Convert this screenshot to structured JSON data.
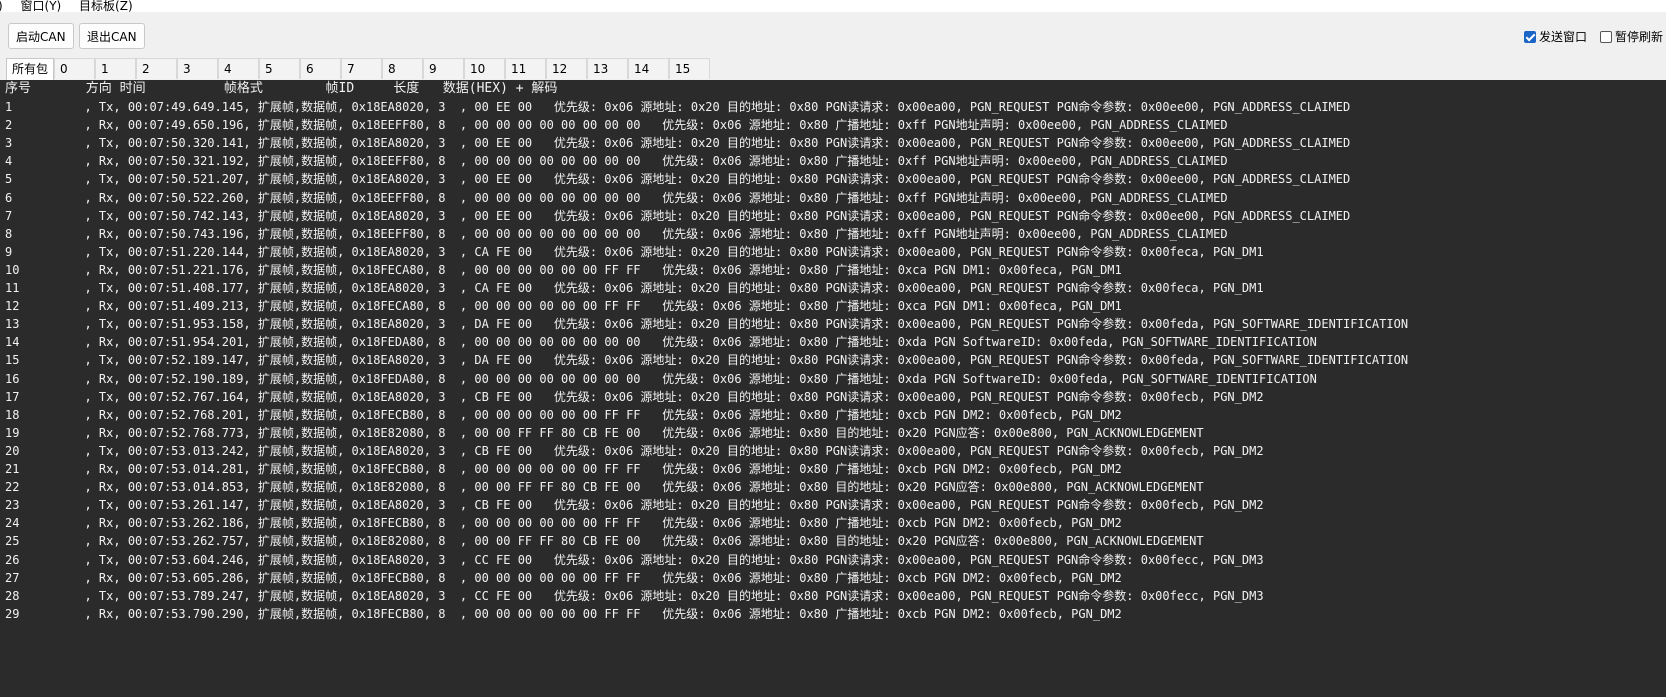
{
  "menu": {
    "lead": ")",
    "items": [
      "窗口(Y)",
      "目标板(Z)"
    ]
  },
  "toolbar": {
    "start_can": "启动CAN",
    "exit_can": "退出CAN",
    "send_window_label": "发送窗口",
    "send_window_checked": true,
    "pause_refresh_label": "暂停刷新",
    "pause_refresh_checked": false
  },
  "tabs": [
    "所有包",
    "0",
    "1",
    "2",
    "3",
    "4",
    "5",
    "6",
    "7",
    "8",
    "9",
    "10",
    "11",
    "12",
    "13",
    "14",
    "15"
  ],
  "console": {
    "header": "序号       方向 时间          帧格式        帧ID     长度   数据(HEX) + 解码",
    "rows": [
      "1          , Tx, 00:07:49.649.145, 扩展帧,数据帧, 0x18EA8020, 3  , 00 EE 00   优先级: 0x06 源地址: 0x20 目的地址: 0x80 PGN读请求: 0x00ea00, PGN_REQUEST PGN命令参数: 0x00ee00, PGN_ADDRESS_CLAIMED",
      "2          , Rx, 00:07:49.650.196, 扩展帧,数据帧, 0x18EEFF80, 8  , 00 00 00 00 00 00 00 00   优先级: 0x06 源地址: 0x80 广播地址: 0xff PGN地址声明: 0x00ee00, PGN_ADDRESS_CLAIMED",
      "3          , Tx, 00:07:50.320.141, 扩展帧,数据帧, 0x18EA8020, 3  , 00 EE 00   优先级: 0x06 源地址: 0x20 目的地址: 0x80 PGN读请求: 0x00ea00, PGN_REQUEST PGN命令参数: 0x00ee00, PGN_ADDRESS_CLAIMED",
      "4          , Rx, 00:07:50.321.192, 扩展帧,数据帧, 0x18EEFF80, 8  , 00 00 00 00 00 00 00 00   优先级: 0x06 源地址: 0x80 广播地址: 0xff PGN地址声明: 0x00ee00, PGN_ADDRESS_CLAIMED",
      "5          , Tx, 00:07:50.521.207, 扩展帧,数据帧, 0x18EA8020, 3  , 00 EE 00   优先级: 0x06 源地址: 0x20 目的地址: 0x80 PGN读请求: 0x00ea00, PGN_REQUEST PGN命令参数: 0x00ee00, PGN_ADDRESS_CLAIMED",
      "6          , Rx, 00:07:50.522.260, 扩展帧,数据帧, 0x18EEFF80, 8  , 00 00 00 00 00 00 00 00   优先级: 0x06 源地址: 0x80 广播地址: 0xff PGN地址声明: 0x00ee00, PGN_ADDRESS_CLAIMED",
      "7          , Tx, 00:07:50.742.143, 扩展帧,数据帧, 0x18EA8020, 3  , 00 EE 00   优先级: 0x06 源地址: 0x20 目的地址: 0x80 PGN读请求: 0x00ea00, PGN_REQUEST PGN命令参数: 0x00ee00, PGN_ADDRESS_CLAIMED",
      "8          , Rx, 00:07:50.743.196, 扩展帧,数据帧, 0x18EEFF80, 8  , 00 00 00 00 00 00 00 00   优先级: 0x06 源地址: 0x80 广播地址: 0xff PGN地址声明: 0x00ee00, PGN_ADDRESS_CLAIMED",
      "9          , Tx, 00:07:51.220.144, 扩展帧,数据帧, 0x18EA8020, 3  , CA FE 00   优先级: 0x06 源地址: 0x20 目的地址: 0x80 PGN读请求: 0x00ea00, PGN_REQUEST PGN命令参数: 0x00feca, PGN_DM1",
      "10         , Rx, 00:07:51.221.176, 扩展帧,数据帧, 0x18FECA80, 8  , 00 00 00 00 00 00 FF FF   优先级: 0x06 源地址: 0x80 广播地址: 0xca PGN DM1: 0x00feca, PGN_DM1",
      "11         , Tx, 00:07:51.408.177, 扩展帧,数据帧, 0x18EA8020, 3  , CA FE 00   优先级: 0x06 源地址: 0x20 目的地址: 0x80 PGN读请求: 0x00ea00, PGN_REQUEST PGN命令参数: 0x00feca, PGN_DM1",
      "12         , Rx, 00:07:51.409.213, 扩展帧,数据帧, 0x18FECA80, 8  , 00 00 00 00 00 00 FF FF   优先级: 0x06 源地址: 0x80 广播地址: 0xca PGN DM1: 0x00feca, PGN_DM1",
      "13         , Tx, 00:07:51.953.158, 扩展帧,数据帧, 0x18EA8020, 3  , DA FE 00   优先级: 0x06 源地址: 0x20 目的地址: 0x80 PGN读请求: 0x00ea00, PGN_REQUEST PGN命令参数: 0x00feda, PGN_SOFTWARE_IDENTIFICATION",
      "14         , Rx, 00:07:51.954.201, 扩展帧,数据帧, 0x18FEDA80, 8  , 00 00 00 00 00 00 00 00   优先级: 0x06 源地址: 0x80 广播地址: 0xda PGN SoftwareID: 0x00feda, PGN_SOFTWARE_IDENTIFICATION",
      "15         , Tx, 00:07:52.189.147, 扩展帧,数据帧, 0x18EA8020, 3  , DA FE 00   优先级: 0x06 源地址: 0x20 目的地址: 0x80 PGN读请求: 0x00ea00, PGN_REQUEST PGN命令参数: 0x00feda, PGN_SOFTWARE_IDENTIFICATION",
      "16         , Rx, 00:07:52.190.189, 扩展帧,数据帧, 0x18FEDA80, 8  , 00 00 00 00 00 00 00 00   优先级: 0x06 源地址: 0x80 广播地址: 0xda PGN SoftwareID: 0x00feda, PGN_SOFTWARE_IDENTIFICATION",
      "17         , Tx, 00:07:52.767.164, 扩展帧,数据帧, 0x18EA8020, 3  , CB FE 00   优先级: 0x06 源地址: 0x20 目的地址: 0x80 PGN读请求: 0x00ea00, PGN_REQUEST PGN命令参数: 0x00fecb, PGN_DM2",
      "18         , Rx, 00:07:52.768.201, 扩展帧,数据帧, 0x18FECB80, 8  , 00 00 00 00 00 00 FF FF   优先级: 0x06 源地址: 0x80 广播地址: 0xcb PGN DM2: 0x00fecb, PGN_DM2",
      "19         , Rx, 00:07:52.768.773, 扩展帧,数据帧, 0x18E82080, 8  , 00 00 FF FF 80 CB FE 00   优先级: 0x06 源地址: 0x80 目的地址: 0x20 PGN应答: 0x00e800, PGN_ACKNOWLEDGEMENT",
      "20         , Tx, 00:07:53.013.242, 扩展帧,数据帧, 0x18EA8020, 3  , CB FE 00   优先级: 0x06 源地址: 0x20 目的地址: 0x80 PGN读请求: 0x00ea00, PGN_REQUEST PGN命令参数: 0x00fecb, PGN_DM2",
      "21         , Rx, 00:07:53.014.281, 扩展帧,数据帧, 0x18FECB80, 8  , 00 00 00 00 00 00 FF FF   优先级: 0x06 源地址: 0x80 广播地址: 0xcb PGN DM2: 0x00fecb, PGN_DM2",
      "22         , Rx, 00:07:53.014.853, 扩展帧,数据帧, 0x18E82080, 8  , 00 00 FF FF 80 CB FE 00   优先级: 0x06 源地址: 0x80 目的地址: 0x20 PGN应答: 0x00e800, PGN_ACKNOWLEDGEMENT",
      "23         , Tx, 00:07:53.261.147, 扩展帧,数据帧, 0x18EA8020, 3  , CB FE 00   优先级: 0x06 源地址: 0x20 目的地址: 0x80 PGN读请求: 0x00ea00, PGN_REQUEST PGN命令参数: 0x00fecb, PGN_DM2",
      "24         , Rx, 00:07:53.262.186, 扩展帧,数据帧, 0x18FECB80, 8  , 00 00 00 00 00 00 FF FF   优先级: 0x06 源地址: 0x80 广播地址: 0xcb PGN DM2: 0x00fecb, PGN_DM2",
      "25         , Rx, 00:07:53.262.757, 扩展帧,数据帧, 0x18E82080, 8  , 00 00 FF FF 80 CB FE 00   优先级: 0x06 源地址: 0x80 目的地址: 0x20 PGN应答: 0x00e800, PGN_ACKNOWLEDGEMENT",
      "26         , Tx, 00:07:53.604.246, 扩展帧,数据帧, 0x18EA8020, 3  , CC FE 00   优先级: 0x06 源地址: 0x20 目的地址: 0x80 PGN读请求: 0x00ea00, PGN_REQUEST PGN命令参数: 0x00fecc, PGN_DM3",
      "27         , Rx, 00:07:53.605.286, 扩展帧,数据帧, 0x18FECB80, 8  , 00 00 00 00 00 00 FF FF   优先级: 0x06 源地址: 0x80 广播地址: 0xcb PGN DM2: 0x00fecb, PGN_DM2",
      "28         , Tx, 00:07:53.789.247, 扩展帧,数据帧, 0x18EA8020, 3  , CC FE 00   优先级: 0x06 源地址: 0x20 目的地址: 0x80 PGN读请求: 0x00ea00, PGN_REQUEST PGN命令参数: 0x00fecc, PGN_DM3",
      "29         , Rx, 00:07:53.790.290, 扩展帧,数据帧, 0x18FECB80, 8  , 00 00 00 00 00 00 FF FF   优先级: 0x06 源地址: 0x80 广播地址: 0xcb PGN DM2: 0x00fecb, PGN_DM2"
    ]
  }
}
